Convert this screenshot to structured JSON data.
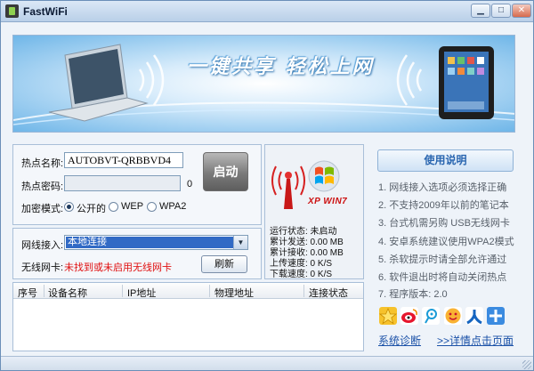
{
  "window": {
    "title": "FastWiFi"
  },
  "banner": {
    "slogan": "一键共享 轻松上网"
  },
  "config": {
    "ssid_label": "热点名称:",
    "ssid_value": "AUTOBVT-QRBBVD4",
    "password_label": "热点密码:",
    "password_value": "",
    "password_length": "0",
    "start_label": "启动",
    "encryption_label": "加密模式:",
    "encryption_options": [
      "公开的",
      "WEP",
      "WPA2"
    ],
    "encryption_selected": "公开的"
  },
  "network": {
    "access_label": "网线接入:",
    "access_value": "本地连接",
    "wireless_label": "无线网卡:",
    "wireless_value": "未找到或未启用无线网卡",
    "refresh_label": "刷新"
  },
  "status": {
    "os_label": "XP WIN7",
    "run_state": "运行状态: 未启动",
    "sent": "累计发送: 0.00 MB",
    "received": "累计接收: 0.00 MB",
    "upload": "上传速度: 0 K/S",
    "download": "下载速度: 0 K/S"
  },
  "device_table": {
    "columns": [
      "序号",
      "设备名称",
      "IP地址",
      "物理地址",
      "连接状态"
    ],
    "rows": []
  },
  "help": {
    "title": "使用说明",
    "tips": [
      "1. 网线接入选项必须选择正确",
      "2. 不支持2009年以前的笔记本",
      "3. 台式机需另购 USB无线网卡",
      "4. 安卓系统建议使用WPA2模式",
      "5. 杀软提示时请全部允许通过",
      "6. 软件退出时将自动关闭热点",
      "7. 程序版本: 2.0"
    ],
    "diagnose_link": "系统诊断",
    "details_link": ">>详情点击页面"
  },
  "share_icons": [
    "qzone-icon",
    "weibo-icon",
    "tencent-weibo-icon",
    "kaixin-icon",
    "renren-icon",
    "more-share-icon"
  ],
  "colors": {
    "accent": "#2a66b0",
    "warning": "#e01010",
    "selection": "#316ac5"
  }
}
